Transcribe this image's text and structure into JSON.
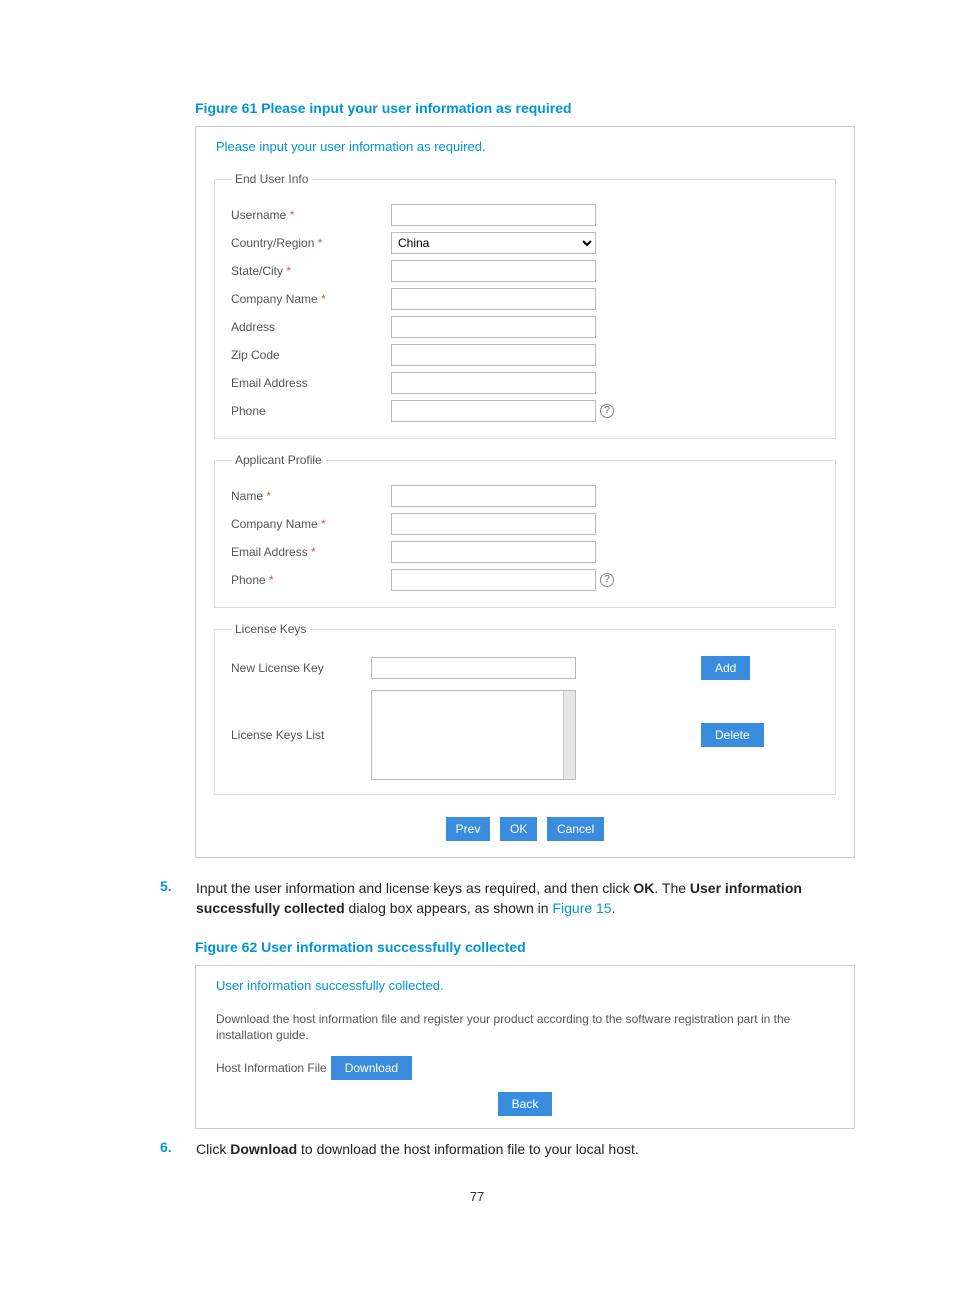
{
  "figure61_caption": "Figure 61 Please input your user information as required",
  "panel1": {
    "title": "Please input your user information as required.",
    "endUserLegend": "End User Info",
    "applicantLegend": "Applicant Profile",
    "licenseLegend": "License Keys",
    "labels": {
      "username": "Username",
      "country": "Country/Region",
      "stateCity": "State/City",
      "companyName": "Company Name",
      "address": "Address",
      "zip": "Zip Code",
      "email": "Email Address",
      "phone": "Phone",
      "appName": "Name",
      "appCompany": "Company Name",
      "appEmail": "Email Address",
      "appPhone": "Phone",
      "newLicense": "New License Key",
      "licenseList": "License Keys List"
    },
    "countryValue": "China",
    "buttons": {
      "add": "Add",
      "delete": "Delete",
      "prev": "Prev",
      "ok": "OK",
      "cancel": "Cancel"
    }
  },
  "step5": {
    "num": "5.",
    "text_a": "Input the user information and license keys as required, and then click ",
    "bold_ok": "OK",
    "text_b": ". The ",
    "bold_ui": "User information successfully collected",
    "text_c": " dialog box appears, as shown in ",
    "link": "Figure 15",
    "text_d": "."
  },
  "figure62_caption": "Figure 62 User information successfully collected",
  "panel2": {
    "title": "User information successfully collected.",
    "body": "Download the host information file and register your product according to the software registration part in the installation guide.",
    "hostFileLabel": "Host Information File",
    "download": "Download",
    "back": "Back"
  },
  "step6": {
    "num": "6.",
    "text_a": "Click ",
    "bold_dl": "Download",
    "text_b": " to download the host information file to your local host."
  },
  "pageNumber": "77"
}
